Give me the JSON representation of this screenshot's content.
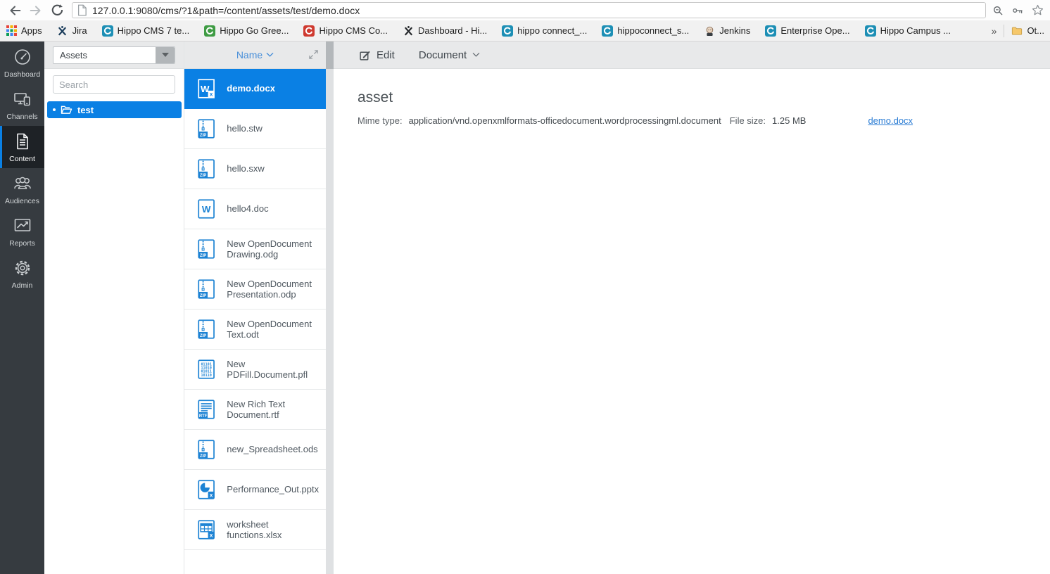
{
  "browser": {
    "url": "127.0.0.1:9080/cms/?1&path=/content/assets/test/demo.docx",
    "overflow_chevron": "»",
    "other_bookmarks_label": "Ot...",
    "bookmarks": [
      {
        "label": "Apps",
        "icon": "apps-grid",
        "color": ""
      },
      {
        "label": "Jira",
        "icon": "charlie-x",
        "color": "#1c3e5c"
      },
      {
        "label": "Hippo CMS 7 te...",
        "icon": "hippo-swirl",
        "color": "#1d8fb5"
      },
      {
        "label": "Hippo Go Gree...",
        "icon": "hippo-swirl",
        "color": "#3f9c44"
      },
      {
        "label": "Hippo CMS Co...",
        "icon": "hippo-swirl",
        "color": "#cf3a30"
      },
      {
        "label": "Dashboard - Hi...",
        "icon": "charlie-x",
        "color": "#26292c"
      },
      {
        "label": "hippo connect_...",
        "icon": "hippo-swirl",
        "color": "#1d8fb5"
      },
      {
        "label": "hippoconnect_s...",
        "icon": "hippo-swirl",
        "color": "#1d8fb5"
      },
      {
        "label": "Jenkins",
        "icon": "jenkins-butler",
        "color": "#e9d6c3"
      },
      {
        "label": "Enterprise Ope...",
        "icon": "hippo-swirl",
        "color": "#1d8fb5"
      },
      {
        "label": "Hippo Campus ...",
        "icon": "hippo-swirl",
        "color": "#1d8fb5"
      }
    ]
  },
  "sidebar": {
    "items": [
      {
        "label": "Dashboard",
        "icon": "gauge-icon",
        "active": false
      },
      {
        "label": "Channels",
        "icon": "devices-icon",
        "active": false
      },
      {
        "label": "Content",
        "icon": "document-icon",
        "active": true
      },
      {
        "label": "Audiences",
        "icon": "people-icon",
        "active": false
      },
      {
        "label": "Reports",
        "icon": "chart-icon",
        "active": false
      },
      {
        "label": "Admin",
        "icon": "gear-icon",
        "active": false
      }
    ]
  },
  "tree": {
    "section_value": "Assets",
    "search_placeholder": "Search",
    "folder_label": "test",
    "folder_selected": true
  },
  "list": {
    "header_label": "Name"
  },
  "files": [
    {
      "name": "demo.docx",
      "icon": "docx",
      "selected": true
    },
    {
      "name": "hello.stw",
      "icon": "zip",
      "selected": false
    },
    {
      "name": "hello.sxw",
      "icon": "zip",
      "selected": false
    },
    {
      "name": "hello4.doc",
      "icon": "doc",
      "selected": false
    },
    {
      "name": "New OpenDocument Drawing.odg",
      "icon": "zip",
      "selected": false
    },
    {
      "name": "New OpenDocument Presentation.odp",
      "icon": "zip",
      "selected": false
    },
    {
      "name": "New OpenDocument Text.odt",
      "icon": "zip",
      "selected": false
    },
    {
      "name": "New PDFill.Document.pfl",
      "icon": "binary",
      "selected": false
    },
    {
      "name": "New Rich Text Document.rtf",
      "icon": "rtf",
      "selected": false
    },
    {
      "name": "new_Spreadsheet.ods",
      "icon": "zip",
      "selected": false
    },
    {
      "name": "Performance_Out.pptx",
      "icon": "pptx",
      "selected": false
    },
    {
      "name": "worksheet functions.xlsx",
      "icon": "xlsx",
      "selected": false
    }
  ],
  "main": {
    "toolbar": {
      "edit_label": "Edit",
      "document_label": "Document"
    },
    "heading": "asset",
    "mime_label": "Mime type:",
    "mime_value": "application/vnd.openxmlformats-officedocument.wordprocessingml.document",
    "size_label": "File size:",
    "size_value": "1.25 MB",
    "download_link": "demo.docx"
  },
  "colors": {
    "selection_blue": "#0a80e4",
    "icon_blue": "#1d83d4",
    "link_blue": "#2a7cd4",
    "sidebar_bg": "#363b40",
    "panel_header_grey": "#e8e9ea"
  }
}
